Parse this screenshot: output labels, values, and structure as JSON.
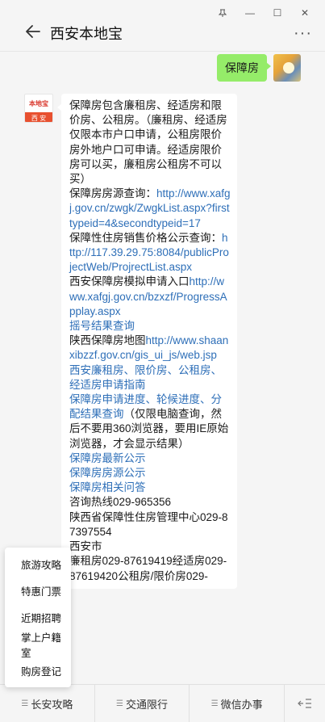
{
  "window": {
    "pin_icon": "pin-icon",
    "minimize": "—",
    "maximize": "☐",
    "close": "✕"
  },
  "header": {
    "title": "西安本地宝",
    "more": "···"
  },
  "chat": {
    "user_message": "保障房",
    "bot_avatar_top": "本地宝",
    "bot_avatar_bottom": "西 安",
    "bot_segments": [
      {
        "t": "保障房包含廉租房、经适房和限价房、公租房。（廉租房、经适房仅限本市户口申请，公租房限价房外地户口可申请。经适房限价房可以买，廉租房公租房不可以买）"
      },
      {
        "t": "保障房房源查询：",
        "link": "http://www.xafgj.gov.cn/zwgk/ZwgkList.aspx?firsttypeid=4&secondtypeid=17"
      },
      {
        "t": "保障性住房销售价格公示查询：",
        "link": "http://117.39.29.75:8084/publicProjectWeb/ProjrectList.aspx"
      },
      {
        "t": "西安保障房模拟申请入口",
        "link": "http://www.xafgj.gov.cn/bzxzf/ProgressApplay.aspx"
      },
      {
        "t": "",
        "link": "摇号结果查询"
      },
      {
        "t": "陕西保障房地图",
        "link": "http://www.shaanxibzzf.gov.cn/gis_ui_js/web.jsp"
      },
      {
        "t": "",
        "link": "西安廉租房、限价房、公租房、经适房申请指南"
      },
      {
        "t": "",
        "link": "保障房申请进度、轮候进度、分配结果查询",
        "after": "（仅限电脑查询，然后不要用360浏览器，要用IE原始浏览器，才会显示结果）"
      },
      {
        "t": "",
        "link": "保障房最新公示"
      },
      {
        "t": "",
        "link": "保障房房源公示"
      },
      {
        "t": "",
        "link": "保障房相关问答"
      },
      {
        "t": "咨询热线029-965356"
      },
      {
        "t": "陕西省保障性住房管理中心029-87397554"
      },
      {
        "t": "西安市"
      },
      {
        "t": "廉租房029-87619419经适房029-87619420公租房/限价房029-"
      }
    ]
  },
  "popup_menu": [
    "旅游攻略",
    "特惠门票",
    "近期招聘",
    "掌上户籍室",
    "购房登记"
  ],
  "bottom_bar": {
    "items": [
      "长安攻略",
      "交通限行",
      "微信办事"
    ],
    "keyboard_icon": "keyboard-toggle-icon"
  }
}
